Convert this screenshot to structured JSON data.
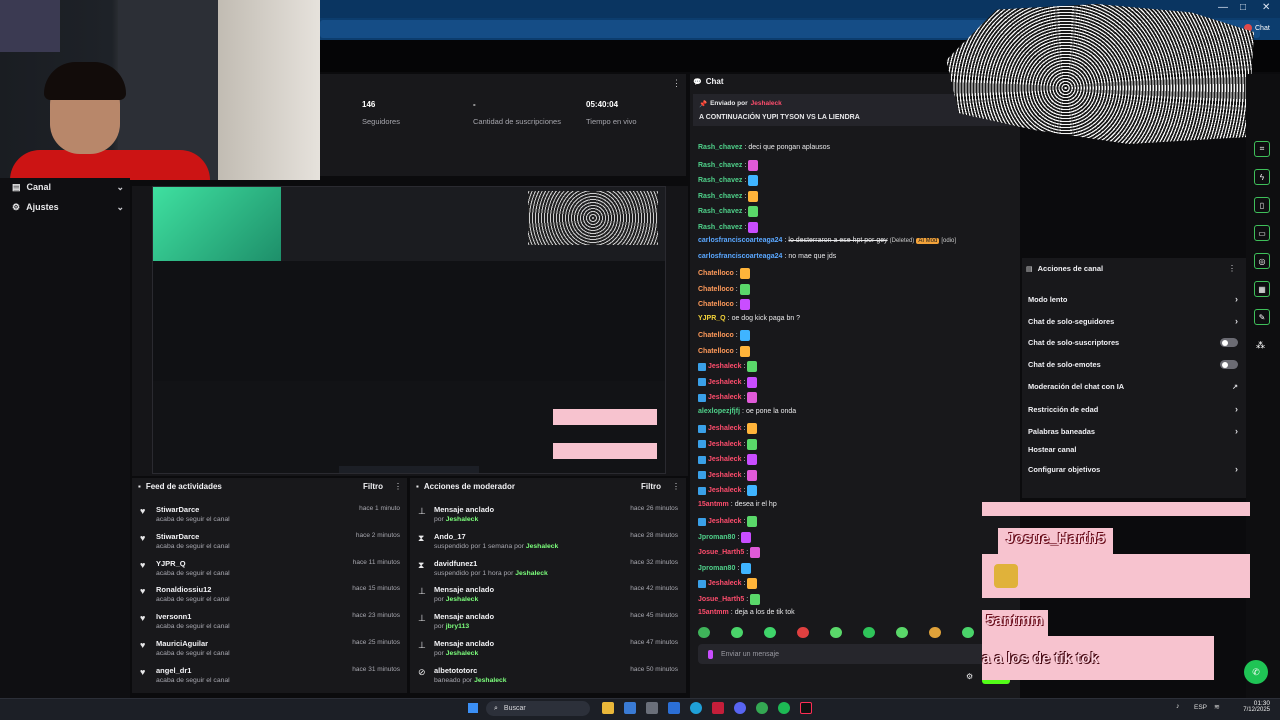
{
  "sidebar": {
    "items": [
      {
        "label": "Canal"
      },
      {
        "label": "Ajustes"
      }
    ]
  },
  "stats": [
    {
      "value": "146",
      "label": "Seguidores"
    },
    {
      "value": "-",
      "label": "Cantidad de suscripciones"
    },
    {
      "value": "05:40:04",
      "label": "Tiempo en vivo"
    }
  ],
  "chat": {
    "title": "Chat",
    "pinned_by": "Enviado por",
    "pinned_user": "Jeshaleck",
    "pinned_message": "A CONTINUACIÓN YUPI TYSON VS LA LIENDRA",
    "input_placeholder": "Enviar un mensaje",
    "messages": [
      {
        "user": "Rash_chavez",
        "text": "deci que pongan aplausos",
        "color": "#4fd18a"
      },
      {
        "user": "Rash_chavez",
        "text": "",
        "color": "#4fd18a"
      },
      {
        "user": "Rash_chavez",
        "text": "",
        "color": "#4fd18a"
      },
      {
        "user": "Rash_chavez",
        "text": "",
        "color": "#4fd18a"
      },
      {
        "user": "Rash_chavez",
        "text": "",
        "color": "#4fd18a"
      },
      {
        "user": "Rash_chavez",
        "text": "",
        "color": "#4fd18a"
      },
      {
        "user": "carlosfranciscoarteaga24",
        "text": "lo desterraron a ese hpt por gey",
        "extra": "(Deleted)",
        "badge": "AI Mod",
        "tail": "[odio]",
        "color": "#5aa7ff"
      },
      {
        "user": "carlosfranciscoarteaga24",
        "text": "no mae que jds",
        "color": "#5aa7ff"
      },
      {
        "user": "Chatelloco",
        "text": "",
        "color": "#ff9a5a"
      },
      {
        "user": "Chatelloco",
        "text": "",
        "color": "#ff9a5a"
      },
      {
        "user": "Chatelloco",
        "text": "",
        "color": "#ff9a5a"
      },
      {
        "user": "YJPR_Q",
        "text": "oe dog kick paga bn ?",
        "color": "#f2d23a"
      },
      {
        "user": "Chatelloco",
        "text": "",
        "color": "#ff9a5a"
      },
      {
        "user": "Chatelloco",
        "text": "",
        "color": "#ff9a5a"
      },
      {
        "user": "Jeshaleck",
        "text": "",
        "color": "#ff4d6d"
      },
      {
        "user": "Jeshaleck",
        "text": "",
        "color": "#ff4d6d"
      },
      {
        "user": "Jeshaleck",
        "text": "",
        "color": "#ff4d6d"
      },
      {
        "user": "alexlopezjfjfj",
        "text": "oe pone la onda",
        "color": "#4fd18a"
      },
      {
        "user": "Jeshaleck",
        "text": "",
        "color": "#ff4d6d"
      },
      {
        "user": "Jeshaleck",
        "text": "",
        "color": "#ff4d6d"
      },
      {
        "user": "Jeshaleck",
        "text": "",
        "color": "#ff4d6d"
      },
      {
        "user": "Jeshaleck",
        "text": "",
        "color": "#ff4d6d"
      },
      {
        "user": "Jeshaleck",
        "text": "",
        "color": "#ff4d6d"
      },
      {
        "user": "15antmm",
        "text": "desea ir el hp",
        "color": "#ff4d6d"
      },
      {
        "user": "Jeshaleck",
        "text": "",
        "color": "#ff4d6d"
      },
      {
        "user": "Jproman80",
        "text": "",
        "color": "#4fd18a"
      },
      {
        "user": "Josue_Harth5",
        "text": "",
        "color": "#ff4d6d"
      },
      {
        "user": "Jproman80",
        "text": "",
        "color": "#4fd18a"
      },
      {
        "user": "Jeshaleck",
        "text": "",
        "color": "#ff4d6d"
      },
      {
        "user": "Josue_Harth5",
        "text": "",
        "color": "#ff4d6d"
      },
      {
        "user": "15antmm",
        "text": "deja a los de tik tok",
        "color": "#ff4d6d"
      }
    ]
  },
  "channel_actions": {
    "title": "Acciones de canal",
    "items": [
      {
        "label": "Modo lento",
        "control": "chevron"
      },
      {
        "label": "Chat de solo-seguidores",
        "control": "chevron"
      },
      {
        "label": "Chat de solo-suscriptores",
        "control": "toggle"
      },
      {
        "label": "Chat de solo-emotes",
        "control": "toggle"
      },
      {
        "label": "Moderación del chat con IA",
        "control": "external"
      },
      {
        "label": "Restricción de edad",
        "control": "chevron"
      },
      {
        "label": "Palabras baneadas",
        "control": "chevron"
      },
      {
        "label": "Hostear canal",
        "control": "none"
      },
      {
        "label": "Configurar objetivos",
        "control": "chevron"
      }
    ]
  },
  "activity_feed": {
    "title": "Feed de actividades",
    "filter": "Filtro",
    "items": [
      {
        "name": "StiwarDarce",
        "sub": "acaba de seguir el canal",
        "time": "hace 1 minuto"
      },
      {
        "name": "StiwarDarce",
        "sub": "acaba de seguir el canal",
        "time": "hace 2 minutos"
      },
      {
        "name": "YJPR_Q",
        "sub": "acaba de seguir el canal",
        "time": "hace 11 minutos"
      },
      {
        "name": "Ronaldiossiu12",
        "sub": "acaba de seguir el canal",
        "time": "hace 15 minutos"
      },
      {
        "name": "Iversonn1",
        "sub": "acaba de seguir el canal",
        "time": "hace 23 minutos"
      },
      {
        "name": "MauriciAguilar",
        "sub": "acaba de seguir el canal",
        "time": "hace 25 minutos"
      },
      {
        "name": "angel_dr1",
        "sub": "acaba de seguir el canal",
        "time": "hace 31 minutos"
      }
    ]
  },
  "mod_actions": {
    "title": "Acciones de moderador",
    "filter": "Filtro",
    "items": [
      {
        "icon": "pin-icon",
        "name": "Mensaje anclado",
        "sub": "por",
        "by": "Jeshaleck",
        "time": "hace 26 minutos"
      },
      {
        "icon": "hourglass-icon",
        "name": "Ando_17",
        "sub": "suspendido por 1 semana por",
        "by": "Jeshaleck",
        "time": "hace 28 minutos"
      },
      {
        "icon": "hourglass-icon",
        "name": "davidfunez1",
        "sub": "suspendido por 1 hora por",
        "by": "Jeshaleck",
        "time": "hace 32 minutos"
      },
      {
        "icon": "pin-icon",
        "name": "Mensaje anclado",
        "sub": "por",
        "by": "Jeshaleck",
        "time": "hace 42 minutos"
      },
      {
        "icon": "pin-icon",
        "name": "Mensaje anclado",
        "sub": "por",
        "by": "jbry113",
        "time": "hace 45 minutos"
      },
      {
        "icon": "pin-icon",
        "name": "Mensaje anclado",
        "sub": "por",
        "by": "Jeshaleck",
        "time": "hace 47 minutos"
      },
      {
        "icon": "ban-icon",
        "name": "albetototorc",
        "sub": "baneado por",
        "by": "Jeshaleck",
        "time": "hace 50 minutos"
      }
    ]
  },
  "overlays": {
    "name1": "Josue_Harth5",
    "name2": "5antmm",
    "text2": "a a los de tik tok"
  },
  "browser": {
    "tab_label": "Chat"
  },
  "taskbar": {
    "search": "Buscar",
    "lang": "ESP",
    "time": "01:30",
    "date": "7/12/2025"
  },
  "colors": {
    "accent": "#53fc18",
    "pink": "#f7c3cf",
    "panel": "#18181b"
  }
}
